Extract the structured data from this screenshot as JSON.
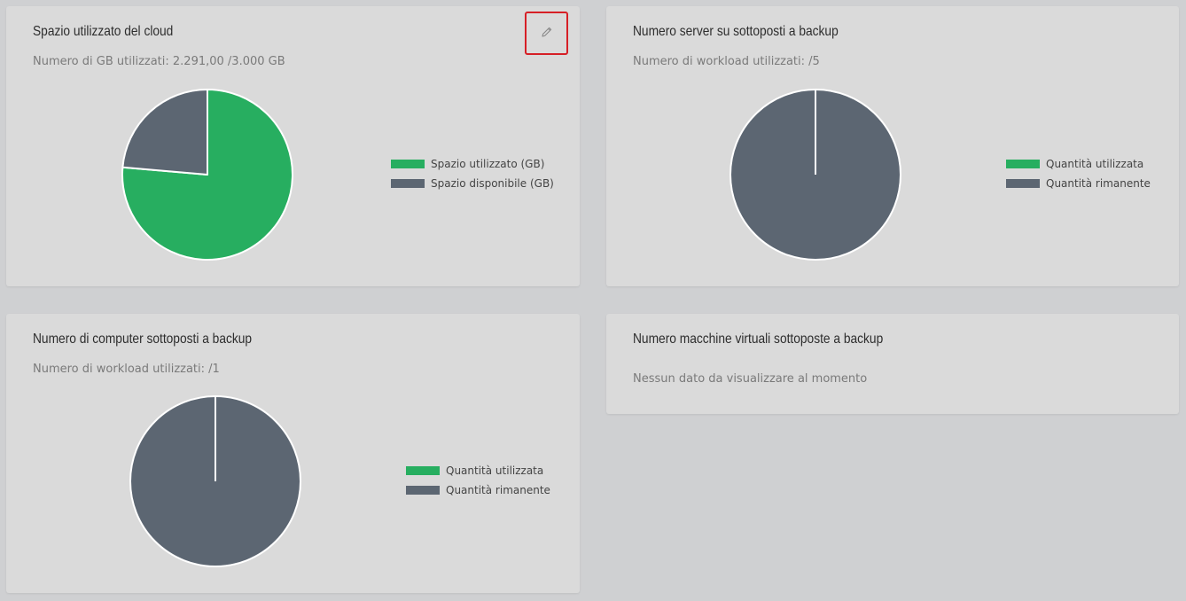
{
  "colors": {
    "used": "#27ae60",
    "remaining": "#5c6672"
  },
  "cards": [
    {
      "title": "Spazio utilizzato del cloud",
      "subtitle": "Numero di GB utilizzati: 2.291,00 /3.000 GB",
      "legend": [
        "Spazio utilizzato (GB)",
        "Spazio disponibile (GB)"
      ],
      "edit_icon": "pencil-icon"
    },
    {
      "title": "Numero server su sottoposti a backup",
      "subtitle": "Numero di workload utilizzati: /5",
      "legend": [
        "Quantità utilizzata",
        "Quantità rimanente"
      ]
    },
    {
      "title": "Numero di computer sottoposti a backup",
      "subtitle": "Numero di workload utilizzati: /1",
      "legend": [
        "Quantità utilizzata",
        "Quantità rimanente"
      ]
    },
    {
      "title": "Numero macchine virtuali sottoposte a backup",
      "subtitle": "Nessun dato da visualizzare al momento"
    }
  ],
  "chart_data": [
    {
      "type": "pie",
      "title": "Spazio utilizzato del cloud",
      "labels": [
        "Spazio utilizzato (GB)",
        "Spazio disponibile (GB)"
      ],
      "values": [
        2291,
        709
      ]
    },
    {
      "type": "pie",
      "title": "Numero server su sottoposti a backup",
      "labels": [
        "Quantità utilizzata",
        "Quantità rimanente"
      ],
      "values": [
        0,
        5
      ]
    },
    {
      "type": "pie",
      "title": "Numero di computer sottoposti a backup",
      "labels": [
        "Quantità utilizzata",
        "Quantità rimanente"
      ],
      "values": [
        0,
        1
      ]
    }
  ]
}
